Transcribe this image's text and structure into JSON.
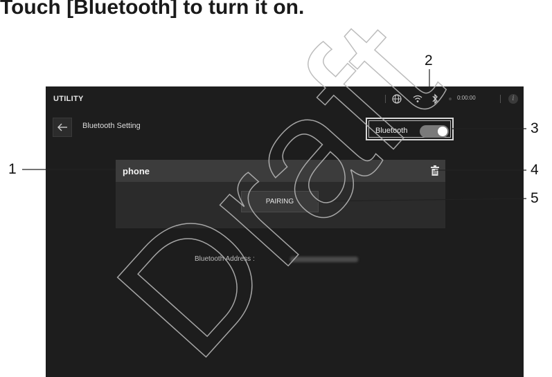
{
  "heading": "Touch [Bluetooth] to turn it on.",
  "watermark": "Draft",
  "callouts": [
    "1",
    "2",
    "3",
    "4",
    "5"
  ],
  "screen": {
    "title": "UTILITY",
    "subtitle": "Bluetooth Setting",
    "status": {
      "icons": [
        "globe-icon",
        "wifi-icon",
        "bluetooth-icon",
        "info-icon"
      ],
      "time": "0:00:00"
    },
    "bluetooth_toggle": {
      "label": "Bluetooth",
      "state": "on"
    },
    "device": {
      "name": "phone",
      "pairing_label": "PAIRING"
    },
    "address_label": "Bluetooth Address :"
  }
}
